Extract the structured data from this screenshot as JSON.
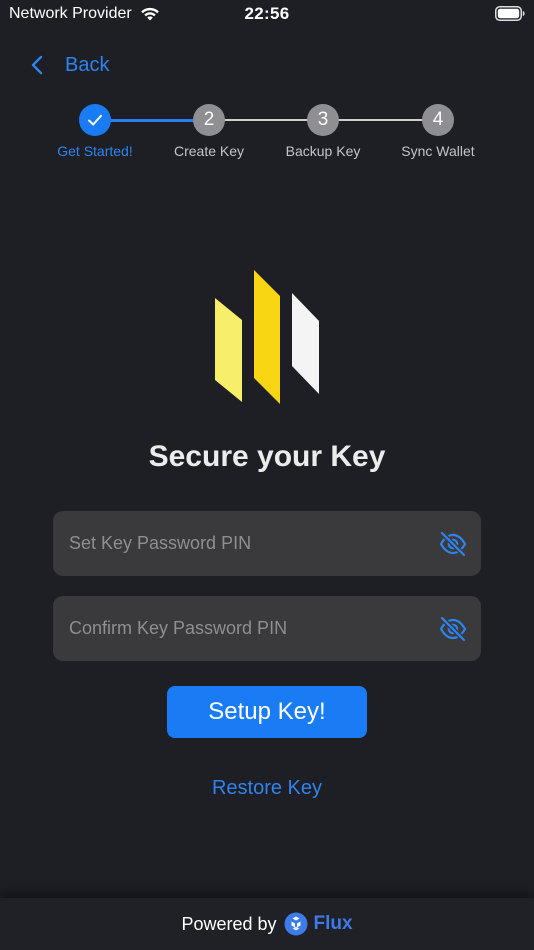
{
  "status_bar": {
    "carrier": "Network Provider",
    "time": "22:56"
  },
  "nav": {
    "back_label": "Back"
  },
  "stepper": {
    "steps": [
      {
        "number": "",
        "label": "Get Started!",
        "state": "completed"
      },
      {
        "number": "2",
        "label": "Create Key",
        "state": "pending"
      },
      {
        "number": "3",
        "label": "Backup Key",
        "state": "pending"
      },
      {
        "number": "4",
        "label": "Sync Wallet",
        "state": "pending"
      }
    ]
  },
  "main": {
    "title": "Secure your Key",
    "pin_field": {
      "value": "",
      "placeholder": "Set Key Password PIN"
    },
    "confirm_field": {
      "value": "",
      "placeholder": "Confirm Key Password PIN"
    },
    "setup_button": "Setup Key!",
    "restore_link": "Restore Key"
  },
  "footer": {
    "powered_by": "Powered by",
    "brand": "Flux"
  },
  "colors": {
    "background": "#1e1f25",
    "accent": "#1a7cf5",
    "link": "#2d84ef",
    "field": "#3a3a3d",
    "logo_yellow_light": "#f7ee6a",
    "logo_yellow": "#f9d613",
    "logo_white": "#f4f4f4"
  }
}
